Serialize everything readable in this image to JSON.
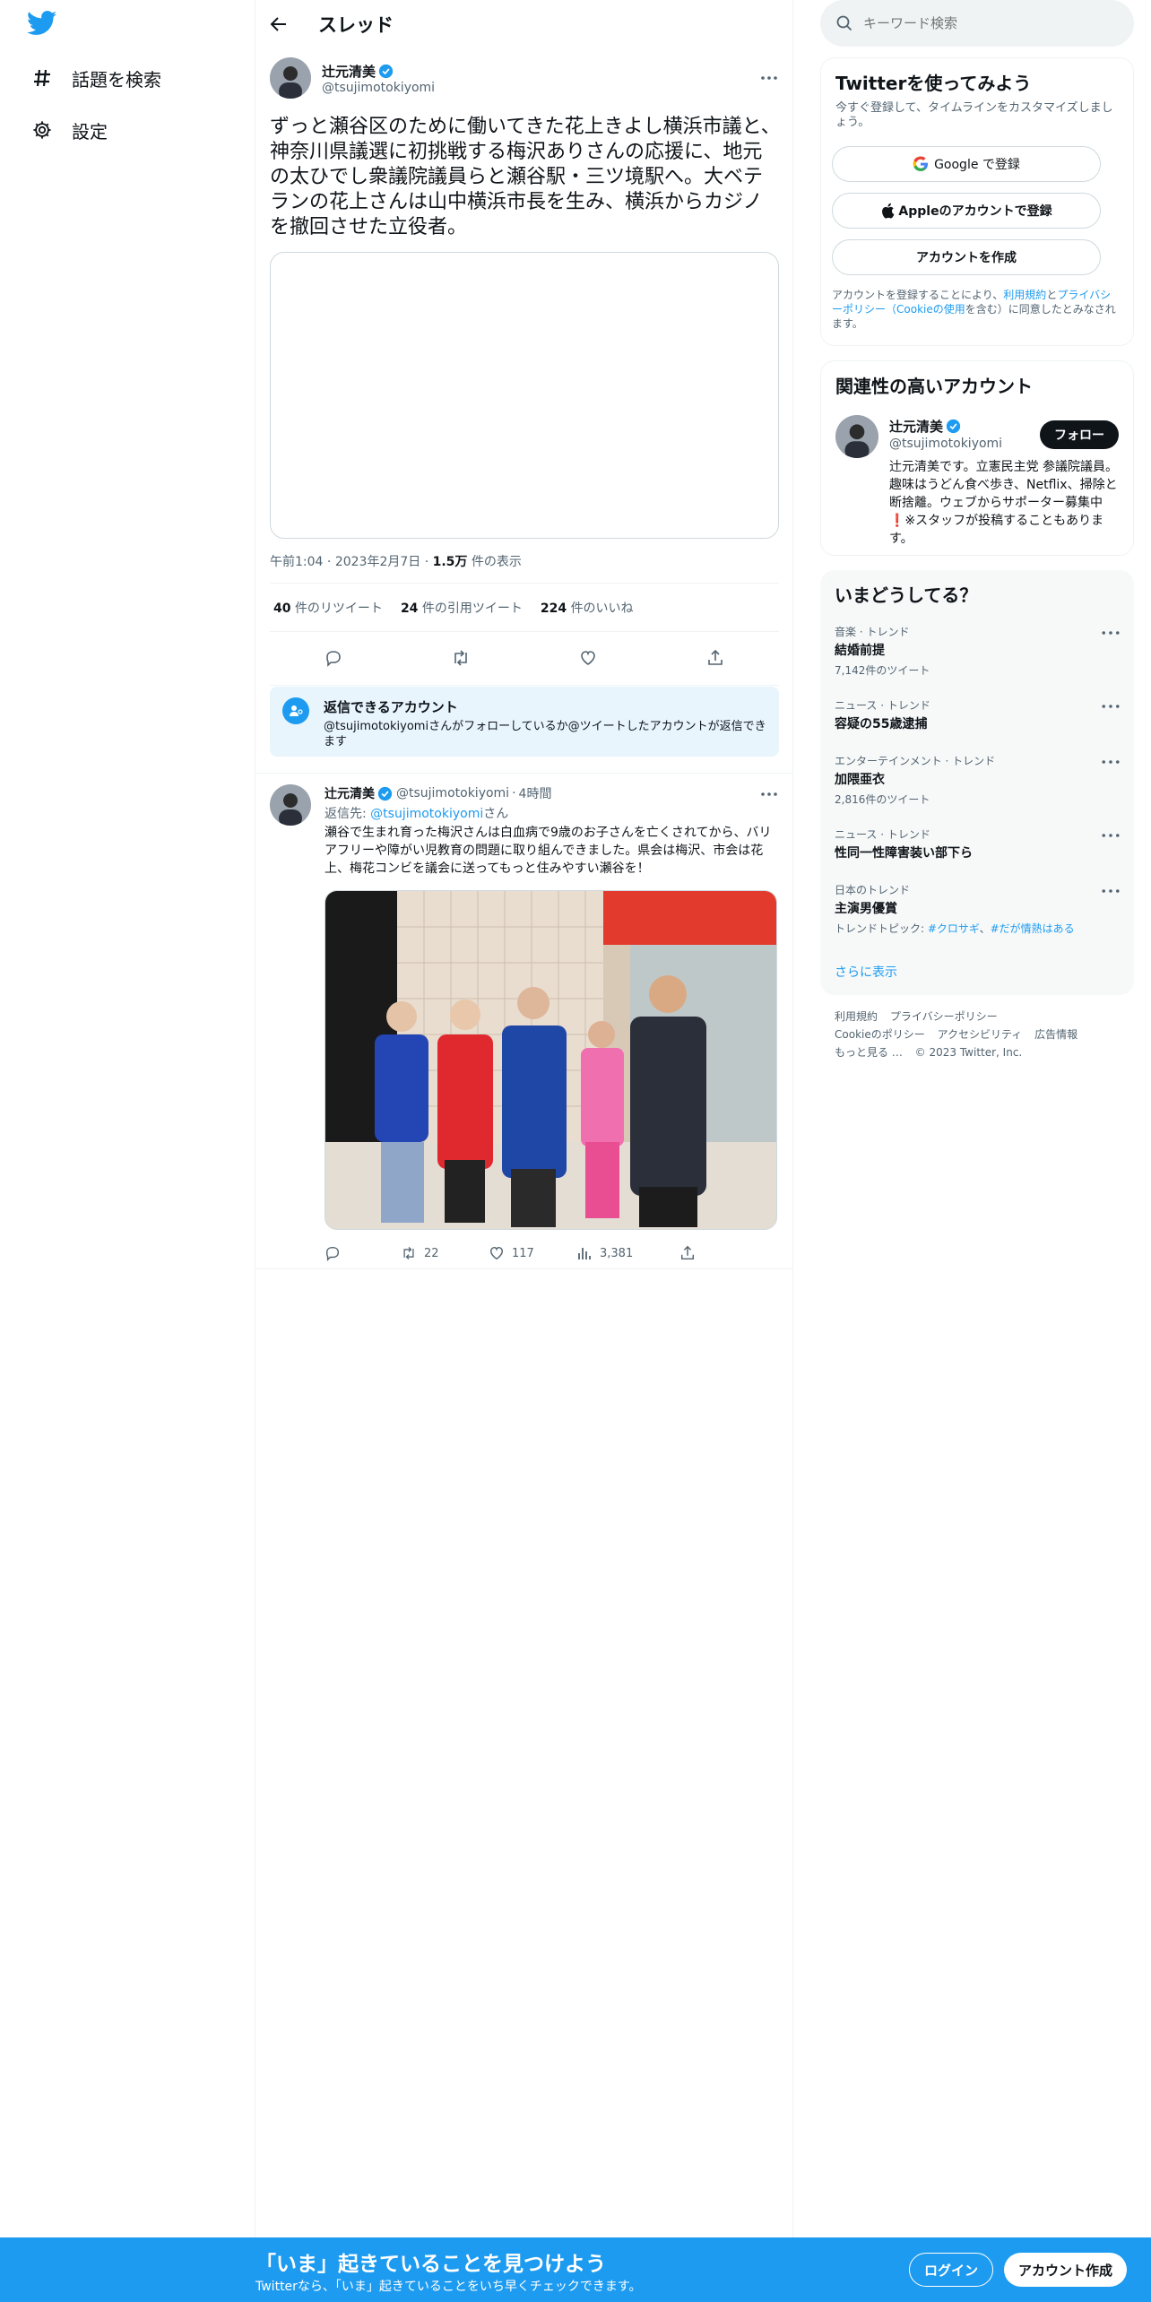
{
  "nav": {
    "logo_icon": "twitter-bird-icon",
    "items": [
      {
        "label": "話題を検索",
        "icon": "hashtag-icon"
      },
      {
        "label": "設定",
        "icon": "gear-icon"
      }
    ]
  },
  "thread": {
    "title": "スレッド",
    "main_tweet": {
      "name": "辻元清美",
      "handle": "@tsujimotokiyomi",
      "text": "ずっと瀬谷区のために働いてきた花上きよし横浜市議と、神奈川県議選に初挑戦する梅沢ありさんの応援に、地元の太ひでし衆議院議員らと瀬谷駅・三ツ境駅へ。大ベテランの花上さんは山中横浜市長を生み、横浜からカジノを撤回させた立役者。",
      "time": "午前1:04",
      "date": "2023年2月7日",
      "views_value": "1.5万",
      "views_label": "件の表示",
      "retweets_value": "40",
      "retweets_label": "件のリツイート",
      "quotes_value": "24",
      "quotes_label": "件の引用ツイート",
      "likes_value": "224",
      "likes_label": "件のいいね"
    },
    "reply_notice": {
      "title": "返信できるアカウント",
      "desc": "@tsujimotokiyomiさんがフォローしているか@ツイートしたアカウントが返信できます"
    },
    "reply_tweet": {
      "name": "辻元清美",
      "handle": "@tsujimotokiyomi",
      "sep": "·",
      "time": "4時間",
      "reply_prefix": "返信先: ",
      "reply_to": "@tsujimotokiyomi",
      "reply_suffix": "さん",
      "text": "瀬谷で生まれ育った梅沢さんは白血病で9歳のお子さんを亡くされてから、バリアフリーや障がい児教育の問題に取り組んできました。県会は梅沢、市会は花上、梅花コンビを議会に送ってもっと住みやすい瀬谷を！",
      "retweets": "22",
      "likes": "117",
      "views": "3,381"
    }
  },
  "search": {
    "placeholder": "キーワード検索"
  },
  "signup": {
    "title": "Twitterを使ってみよう",
    "subtitle": "今すぐ登録して、タイムラインをカスタマイズしましょう。",
    "google": "Google で登録",
    "apple": "Appleのアカウントで登録",
    "create": "アカウントを作成",
    "terms_1": "アカウントを登録することにより、",
    "terms_link1": "利用規約",
    "terms_2": "と",
    "terms_link2": "プライバシーポリシー（Cookieの使用",
    "terms_3": "を含む）に同意したとみなされます。"
  },
  "related": {
    "title": "関連性の高いアカウント",
    "name": "辻元清美",
    "handle": "@tsujimotokiyomi",
    "follow": "フォロー",
    "bio": "辻元清美です。立憲民主党 参議院議員。趣味はうどん食べ歩き、Netflix、掃除と断捨離。ウェブからサポーター募集中❗️※スタッフが投稿することもあります。"
  },
  "trends": {
    "title": "いまどうしてる？",
    "items": [
      {
        "category": "音楽 · トレンド",
        "name": "結婚前提",
        "count": "7,142件のツイート"
      },
      {
        "category": "ニュース · トレンド",
        "name": "容疑の55歳逮捕",
        "count": ""
      },
      {
        "category": "エンターテインメント · トレンド",
        "name": "加隈亜衣",
        "count": "2,816件のツイート"
      },
      {
        "category": "ニュース · トレンド",
        "name": "性同一性障害装い部下ら",
        "count": ""
      },
      {
        "category": "日本のトレンド",
        "name": "主演男優賞",
        "count": "トレンドトピック: ",
        "link1": "#クロサギ",
        "sep": "、",
        "link2": "#だが情熱はある"
      }
    ],
    "show_more": "さらに表示"
  },
  "footer": {
    "links": [
      "利用規約",
      "プライバシーポリシー",
      "Cookieのポリシー",
      "アクセシビリティ",
      "広告情報",
      "もっと見る …",
      "© 2023 Twitter, Inc."
    ]
  },
  "banner": {
    "title": "「いま」起きていることを見つけよう",
    "subtitle": "Twitterなら、「いま」起きていることをいち早くチェックできます。",
    "login": "ログイン",
    "create": "アカウント作成"
  },
  "colors": {
    "accent": "#1d9bf0",
    "text": "#0f1419",
    "muted": "#536471"
  }
}
